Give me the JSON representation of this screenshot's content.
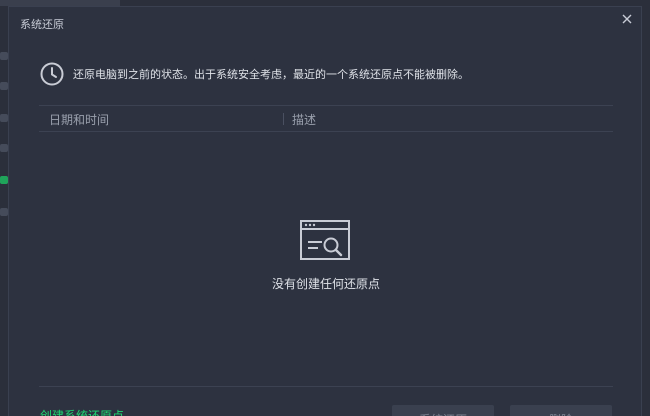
{
  "dialog": {
    "title": "系统还原",
    "close_icon": "close-icon",
    "info_icon": "clock-icon",
    "info_text": "还原电脑到之前的状态。出于系统安全考虑，最近的一个系统还原点不能被删除。"
  },
  "table": {
    "columns": [
      {
        "label": "日期和时间"
      },
      {
        "label": "描述"
      }
    ],
    "rows": []
  },
  "empty_state": {
    "icon": "window-search-icon",
    "text": "没有创建任何还原点"
  },
  "footer": {
    "create_link": "创建系统还原点",
    "restore_button": "系统还原",
    "delete_button": "删除",
    "link_color": "#1fd66f"
  }
}
